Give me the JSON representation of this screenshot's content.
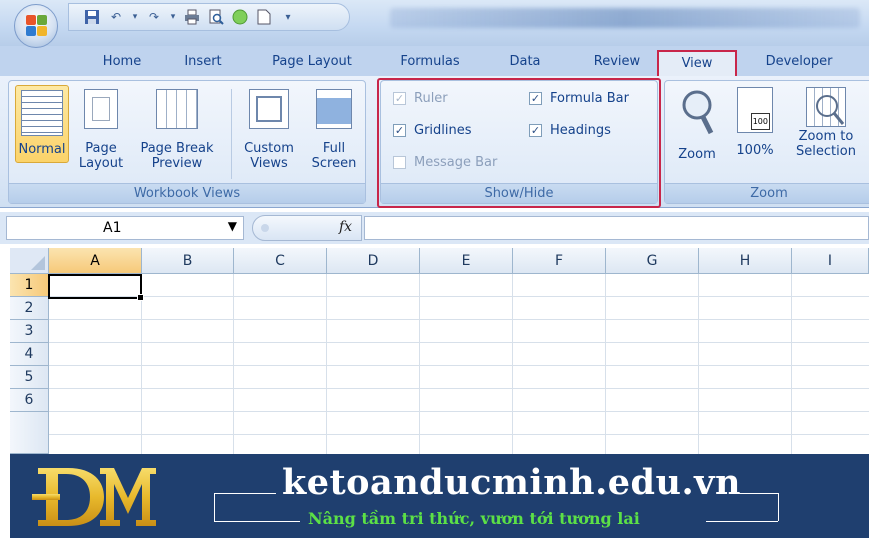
{
  "quick_access": {
    "icons": [
      "save-icon",
      "undo-icon",
      "redo-icon",
      "print-icon",
      "print-preview-icon",
      "circle-icon",
      "new-document-icon",
      "customize-icon"
    ]
  },
  "tabs": [
    {
      "label": "Home"
    },
    {
      "label": "Insert"
    },
    {
      "label": "Page Layout"
    },
    {
      "label": "Formulas"
    },
    {
      "label": "Data"
    },
    {
      "label": "Review"
    },
    {
      "label": "View"
    },
    {
      "label": "Developer"
    }
  ],
  "active_tab": "View",
  "ribbon": {
    "workbook_views": {
      "label": "Workbook Views",
      "normal": "Normal",
      "page_layout": [
        "Page",
        "Layout"
      ],
      "page_break": [
        "Page Break",
        "Preview"
      ],
      "custom_views": [
        "Custom",
        "Views"
      ],
      "full_screen": [
        "Full",
        "Screen"
      ]
    },
    "show_hide": {
      "label": "Show/Hide",
      "ruler": "Ruler",
      "gridlines": "Gridlines",
      "message_bar": "Message Bar",
      "formula_bar": "Formula Bar",
      "headings": "Headings",
      "checks": {
        "ruler": true,
        "gridlines": true,
        "message_bar": false,
        "formula_bar": true,
        "headings": true
      }
    },
    "zoom": {
      "label": "Zoom",
      "zoom": "Zoom",
      "hundred": "100%",
      "zoom_selection": [
        "Zoom to",
        "Selection"
      ],
      "hundred_icon_text": "100"
    }
  },
  "formula_bar": {
    "name_box": "A1",
    "fx": "fx"
  },
  "grid": {
    "columns": [
      "A",
      "B",
      "C",
      "D",
      "E",
      "F",
      "G",
      "H",
      "I"
    ],
    "rows": [
      "1",
      "2",
      "3",
      "4",
      "5",
      "6"
    ],
    "active_cell": "A1"
  },
  "banner": {
    "logo_text": "ĐM",
    "domain": "ketoanducminh.edu.vn",
    "slogan": "Nâng tầm tri thức, vươn tới tương lai"
  },
  "colors": {
    "highlight": "#c8264a",
    "banner_bg": "#1f3f6f",
    "slogan": "#5ce046",
    "logo_gold": "#e8b92c"
  }
}
